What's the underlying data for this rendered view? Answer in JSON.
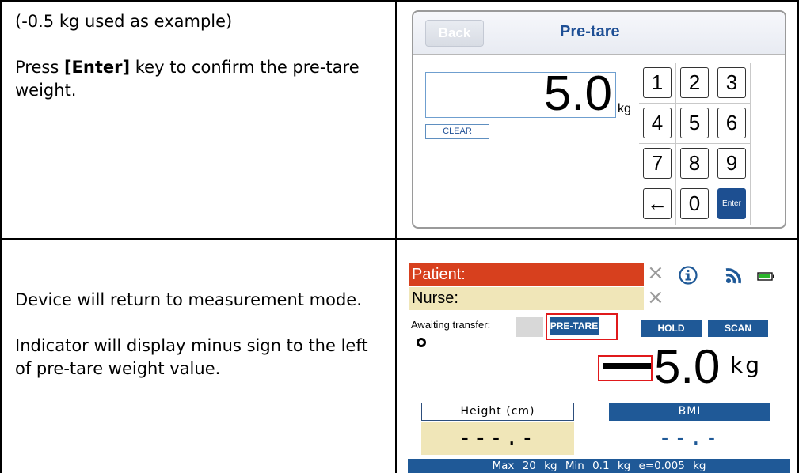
{
  "row1": {
    "note": "(-0.5 kg used as example)",
    "instruction_prefix": "Press ",
    "instruction_key": "[Enter]",
    "instruction_suffix": " key to confirm the pre-tare weight."
  },
  "pretare_screen": {
    "back_label": "Back",
    "title": "Pre-tare",
    "value": "5.0",
    "unit": "kg",
    "clear_label": "CLEAR",
    "keys": [
      "1",
      "2",
      "3",
      "4",
      "5",
      "6",
      "7",
      "8",
      "9",
      "←",
      "0",
      "Enter"
    ],
    "colors": {
      "title": "#1e4f95",
      "enter_key": "#1d4f91"
    }
  },
  "row2": {
    "line1": "Device will return to measurement mode.",
    "line2": "Indicator will display minus sign to the left of pre-tare weight value."
  },
  "measure_screen": {
    "patient_label": "Patient:",
    "nurse_label": "Nurse:",
    "clear_symbol": "×",
    "awaiting_label": "Awaiting transfer:",
    "pretare_button": "PRE-TARE",
    "hold_button": "HOLD",
    "scan_button": "SCAN",
    "weight_value": "5.0",
    "weight_sign": "-",
    "weight_unit": "kg",
    "height_label": "Height (cm)",
    "height_value": "---.-",
    "bmi_label": "BMI",
    "bmi_value": "--.-",
    "footer": "Max 20 kg   Min 0.1 kg   e=0.005 kg",
    "icons": [
      "info-icon",
      "wifi-icon",
      "battery-icon"
    ],
    "colors": {
      "patient_bg": "#d7401e",
      "nurse_bg": "#f0e6b8",
      "button_blue": "#1f5997",
      "highlight_red": "#e0191b",
      "battery_green": "#2bb52b"
    }
  }
}
